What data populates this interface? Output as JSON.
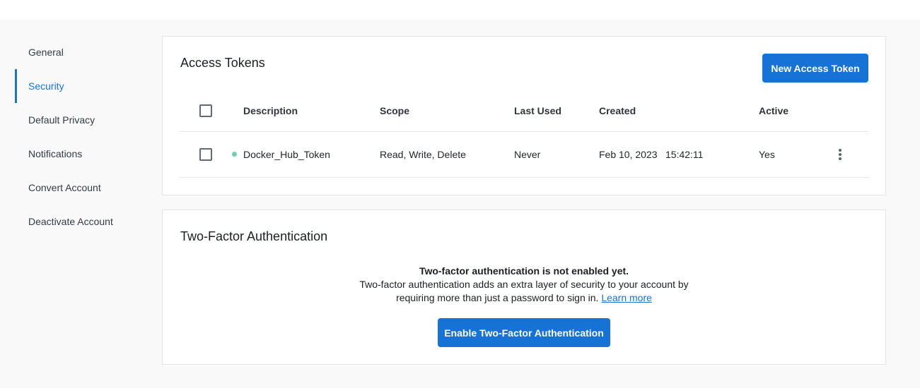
{
  "sidebar": {
    "items": [
      {
        "label": "General",
        "active": false
      },
      {
        "label": "Security",
        "active": true
      },
      {
        "label": "Default Privacy",
        "active": false
      },
      {
        "label": "Notifications",
        "active": false
      },
      {
        "label": "Convert Account",
        "active": false
      },
      {
        "label": "Deactivate Account",
        "active": false
      }
    ]
  },
  "tokens": {
    "title": "Access Tokens",
    "new_button": "New Access Token",
    "columns": [
      "Description",
      "Scope",
      "Last Used",
      "Created",
      "Active"
    ],
    "rows": [
      {
        "description": "Docker_Hub_Token",
        "scope": "Read, Write, Delete",
        "last_used": "Never",
        "created_date": "Feb 10, 2023",
        "created_time": "15:42:11",
        "active": "Yes"
      }
    ]
  },
  "two_factor": {
    "title": "Two-Factor Authentication",
    "status": "Two-factor authentication is not enabled yet.",
    "desc_line1": "Two-factor authentication adds an extra layer of security to your account by",
    "desc_line2": "requiring more than just a password to sign in.",
    "learn_more": "Learn more",
    "enable_button": "Enable Two-Factor Authentication"
  },
  "colors": {
    "accent": "#1672d4",
    "status_active": "#72d1ad",
    "page_bg": "#f9f9f9"
  }
}
